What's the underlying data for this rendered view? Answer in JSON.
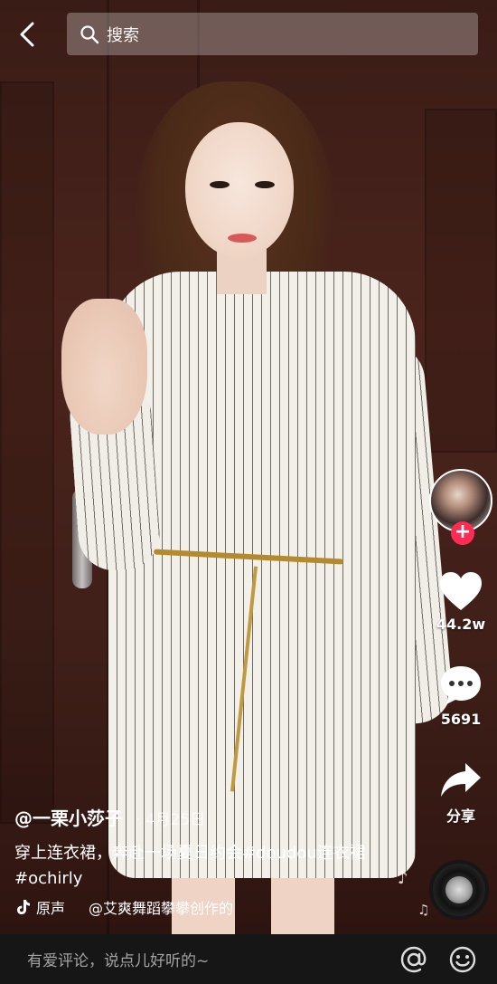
{
  "search": {
    "placeholder": "搜索"
  },
  "creator": {
    "handle": "@一栗小莎子",
    "date": "4月25日"
  },
  "caption": "穿上连衣裙，奔赴一场夏日约会#doudou连衣裙 #ochirly",
  "music": {
    "text_a": "原声",
    "text_b": "@艾爽舞蹈攀攀创作的"
  },
  "actions": {
    "likes": "44.2w",
    "comments": "5691",
    "share": "分享"
  },
  "comment_bar": {
    "placeholder": "有爱评论，说点儿好听的~"
  },
  "colors": {
    "follow": "#fe2c55",
    "accent_belt": "#c09a40"
  },
  "icons": [
    "back-icon",
    "search-icon",
    "heart-icon",
    "comment-icon",
    "share-icon",
    "tiktok-note-icon",
    "at-icon",
    "emoji-icon",
    "music-note-icon"
  ]
}
